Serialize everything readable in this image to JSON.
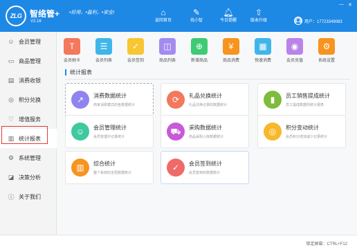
{
  "header": {
    "logo_text": "ZLG",
    "app_name": "智络管+",
    "version": "V2.16",
    "slogan": "•好用，•盈利，•安全!",
    "nav": [
      {
        "icon": "home-icon",
        "label": "返回首页"
      },
      {
        "icon": "pencil-icon",
        "label": "找小智"
      },
      {
        "icon": "bell-icon",
        "label": "今日提醒"
      },
      {
        "icon": "upgrade-icon",
        "label": "版本升级"
      }
    ],
    "user_label": "用户：17723349083",
    "window_controls": {
      "minimize": "—",
      "close": "✕"
    }
  },
  "sidebar": {
    "items": [
      {
        "icon": "member-icon",
        "label": "会员管理"
      },
      {
        "icon": "goods-icon",
        "label": "商品管理"
      },
      {
        "icon": "cashier-icon",
        "label": "消费收银"
      },
      {
        "icon": "points-icon",
        "label": "积分兑换"
      },
      {
        "icon": "heart-icon",
        "label": "增值服务"
      },
      {
        "icon": "stats-icon",
        "label": "统计报表",
        "active": true
      },
      {
        "icon": "settings-icon",
        "label": "系统管理"
      },
      {
        "icon": "analysis-icon",
        "label": "决策分析"
      },
      {
        "icon": "info-icon",
        "label": "关于我们"
      }
    ]
  },
  "quick_actions": [
    {
      "icon": "card-icon",
      "label": "会员刷卡",
      "color": "#f3785c"
    },
    {
      "icon": "list-icon",
      "label": "会员列表",
      "color": "#3fb6ea"
    },
    {
      "icon": "checkin-icon",
      "label": "会员签到",
      "color": "#f7c632"
    },
    {
      "icon": "bag-icon",
      "label": "商品列表",
      "color": "#a38bef"
    },
    {
      "icon": "plus-icon",
      "label": "新增商品",
      "color": "#3ecb74"
    },
    {
      "icon": "consume-icon",
      "label": "商品消费",
      "color": "#f7941e"
    },
    {
      "icon": "fast-consume-icon",
      "label": "快速消费",
      "color": "#3fb6ea"
    },
    {
      "icon": "recharge-icon",
      "label": "会员充值",
      "color": "#b983e9"
    },
    {
      "icon": "gear-icon",
      "label": "系统设置",
      "color": "#f7941e"
    }
  ],
  "section": {
    "title": "统计报表"
  },
  "cards": [
    {
      "icon": "chart-line-icon",
      "title": "消费数据统计",
      "desc": "商家消费模式的各数据统计",
      "color": "#8f84ee"
    },
    {
      "icon": "refresh-icon",
      "title": "礼品兑换统计",
      "desc": "礼品兑换记录的数据统计",
      "color": "#f3785c"
    },
    {
      "icon": "bar-chart-icon",
      "title": "员工销售提成统计",
      "desc": "员工提成数据的统计报表",
      "color": "#7dbc3c"
    },
    {
      "icon": "member-stat-icon",
      "title": "会员管理统计",
      "desc": "会员管理中记录统计",
      "color": "#3ec9a0"
    },
    {
      "icon": "cart-icon",
      "title": "采购数据统计",
      "desc": "商品采购入库数据统计",
      "color": "#c859d8"
    },
    {
      "icon": "coins-icon",
      "title": "积分变动统计",
      "desc": "会员积分增加减少记录统计",
      "color": "#f7b82a"
    },
    {
      "icon": "bars-icon",
      "title": "综合统计",
      "desc": "整个系统的全局数据统计",
      "color": "#f7941e"
    },
    {
      "icon": "checkin-stat-icon",
      "title": "会员签到统计",
      "desc": "会员签到的数据统计",
      "color": "#f06a6a"
    }
  ],
  "status": {
    "shortcut": "锁定屏幕：CTRL+F12"
  }
}
